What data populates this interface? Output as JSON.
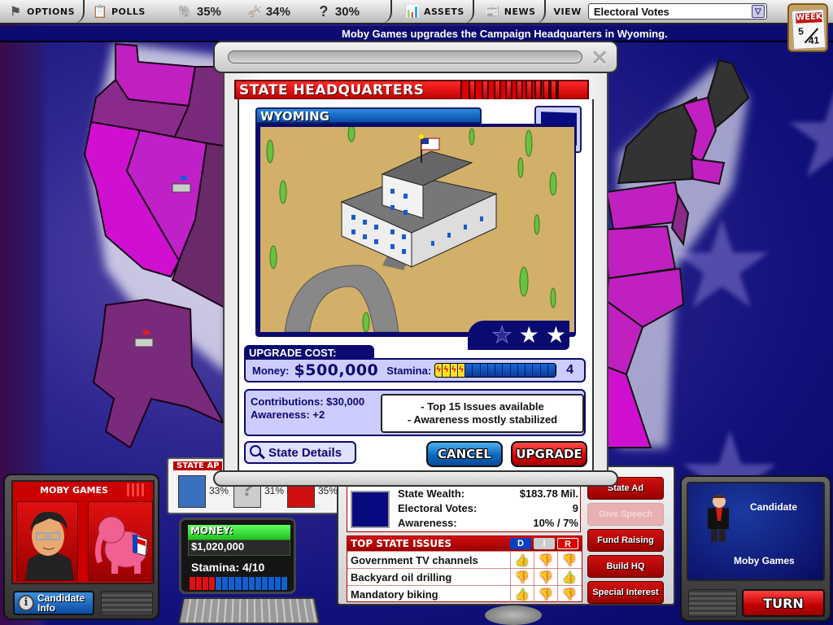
{
  "toolbar": {
    "options_label": "OPTIONS",
    "polls_label": "POLLS",
    "polls": [
      {
        "party": "republican",
        "icon": "elephant-icon",
        "value": "35%"
      },
      {
        "party": "democrat",
        "icon": "donkey-icon",
        "value": "34%"
      },
      {
        "party": "undecided",
        "icon": "question-icon",
        "value": "30%"
      }
    ],
    "assets_label": "ASSETS",
    "news_label": "NEWS",
    "view_label": "VIEW",
    "view_selected": "Electoral Votes"
  },
  "ticker": {
    "message": "Moby Games upgrades the Campaign Headquarters in Wyoming."
  },
  "week": {
    "label": "WEEK",
    "current": "5",
    "total": "41"
  },
  "modal": {
    "title": "STATE HEADQUARTERS",
    "state_name": "WYOMING",
    "hq_level": {
      "current": 2,
      "max": 3
    },
    "upgrade_cost_label": "UPGRADE COST:",
    "money_label": "Money:",
    "money_value": "$500,000",
    "stamina_label": "Stamina:",
    "stamina_cost": "4",
    "stamina_cost_fraction": 0.25,
    "contributions": "Contributions: $30,000",
    "awareness": "Awareness: +2",
    "notes": [
      "- Top 15 Issues available",
      "- Awareness mostly stabilized"
    ],
    "state_details_label": "State Details",
    "cancel_label": "CANCEL",
    "upgrade_label": "UPGRADE"
  },
  "candidate": {
    "name": "MOBY GAMES",
    "info_label_1": "Candidate",
    "info_label_2": "Info"
  },
  "approval": {
    "header": "STATE AP",
    "values": [
      "33%",
      "31%",
      "35%"
    ]
  },
  "finances": {
    "money_label": "MONEY:",
    "money_value": "$1,020,000",
    "stamina_text": "Stamina: 4/10",
    "stamina_fraction": 0.4
  },
  "state_info": {
    "rows": [
      {
        "label": "State Wealth:",
        "value": "$183.78 Mil."
      },
      {
        "label": "Electoral Votes:",
        "value": "9"
      },
      {
        "label": "Awareness:",
        "value": "10% / 7%"
      }
    ]
  },
  "issues": {
    "title": "TOP STATE ISSUES",
    "columns": [
      "D",
      "I",
      "R"
    ],
    "rows": [
      {
        "issue": "Government TV channels",
        "stances": [
          "up",
          "down",
          "down"
        ]
      },
      {
        "issue": "Backyard oil drilling",
        "stances": [
          "down",
          "down",
          "up"
        ]
      },
      {
        "issue": "Mandatory biking",
        "stances": [
          "up",
          "down",
          "down"
        ]
      }
    ]
  },
  "actions": [
    {
      "label": "State Ad",
      "enabled": true
    },
    {
      "label": "Give Speech",
      "enabled": false
    },
    {
      "label": "Fund Raising",
      "enabled": true
    },
    {
      "label": "Build HQ",
      "enabled": true
    },
    {
      "label": "Special Interest",
      "enabled": true
    }
  ],
  "turn_panel": {
    "role": "Candidate",
    "name": "Moby Games",
    "turn_label": "TURN"
  },
  "colors": {
    "republican": "#cc0000",
    "democrat": "#0a4aa8",
    "accent_navy": "#0a0a70"
  }
}
